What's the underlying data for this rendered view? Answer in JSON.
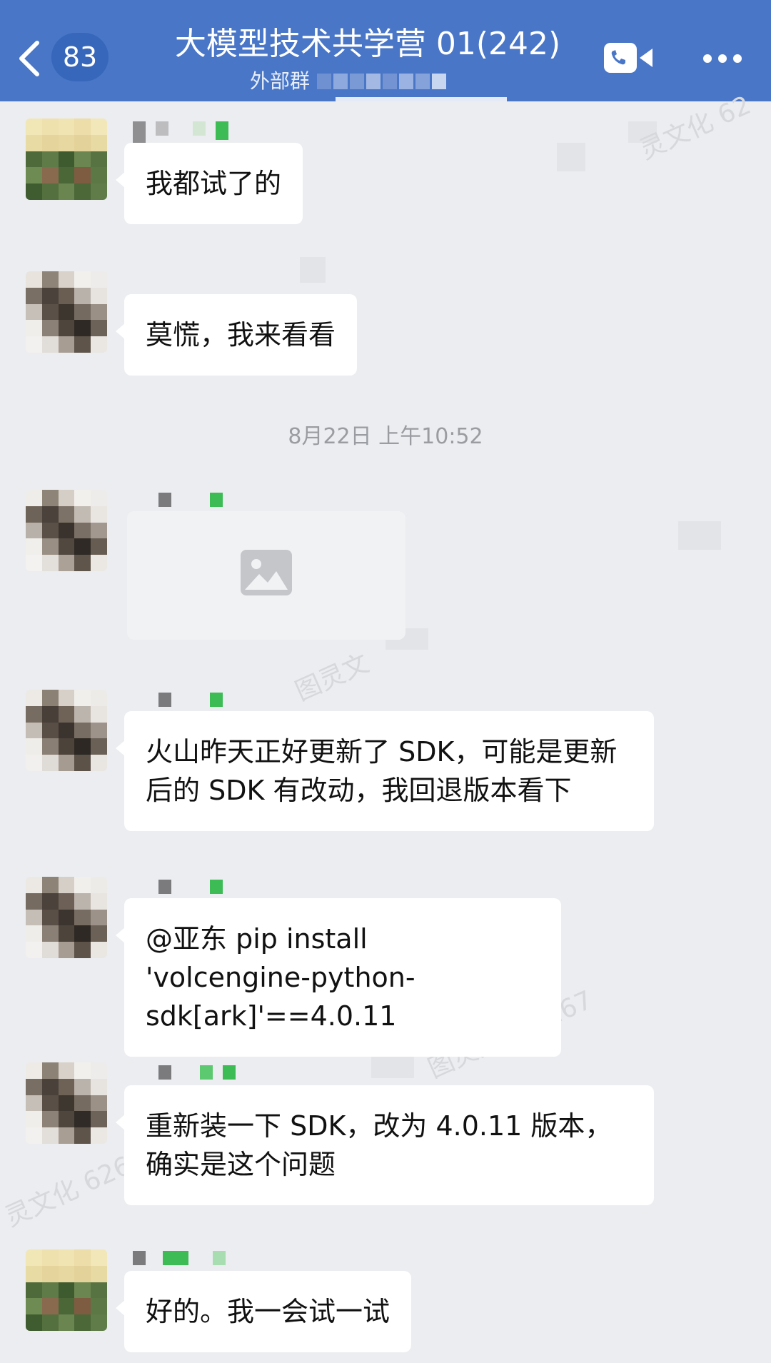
{
  "header": {
    "unread_count": "83",
    "title": "大模型技术共学营 01(242)",
    "subtitle": "外部群",
    "icons": [
      "back-arrow-icon",
      "video-call-icon",
      "more-icon"
    ],
    "color": "#4976C7"
  },
  "messages": [
    {
      "text": "我都试了的"
    },
    {
      "text": "莫慌，我来看看"
    },
    {
      "type": "image",
      "icon": "image-placeholder-icon"
    },
    {
      "text": "火山昨天正好更新了 SDK，可能是更新后的 SDK 有改动，我回退版本看下"
    },
    {
      "text": "@亚东 pip install 'volcengine-python-sdk[ark]'==4.0.11"
    },
    {
      "text": "重新装一下 SDK，改为 4.0.11 版本，确实是这个问题"
    },
    {
      "text": "好的。我一会试一试"
    }
  ],
  "timestamp": "8月22日 上午10:52",
  "watermarks": [
    "灵文化 62",
    "图灵文",
    "图灵文化 6267",
    "灵文化 626"
  ],
  "colors": {
    "background": "#EBEDF0",
    "bubble": "#FFFFFF",
    "text": "#111111",
    "timestamp": "#9A9CA1"
  }
}
